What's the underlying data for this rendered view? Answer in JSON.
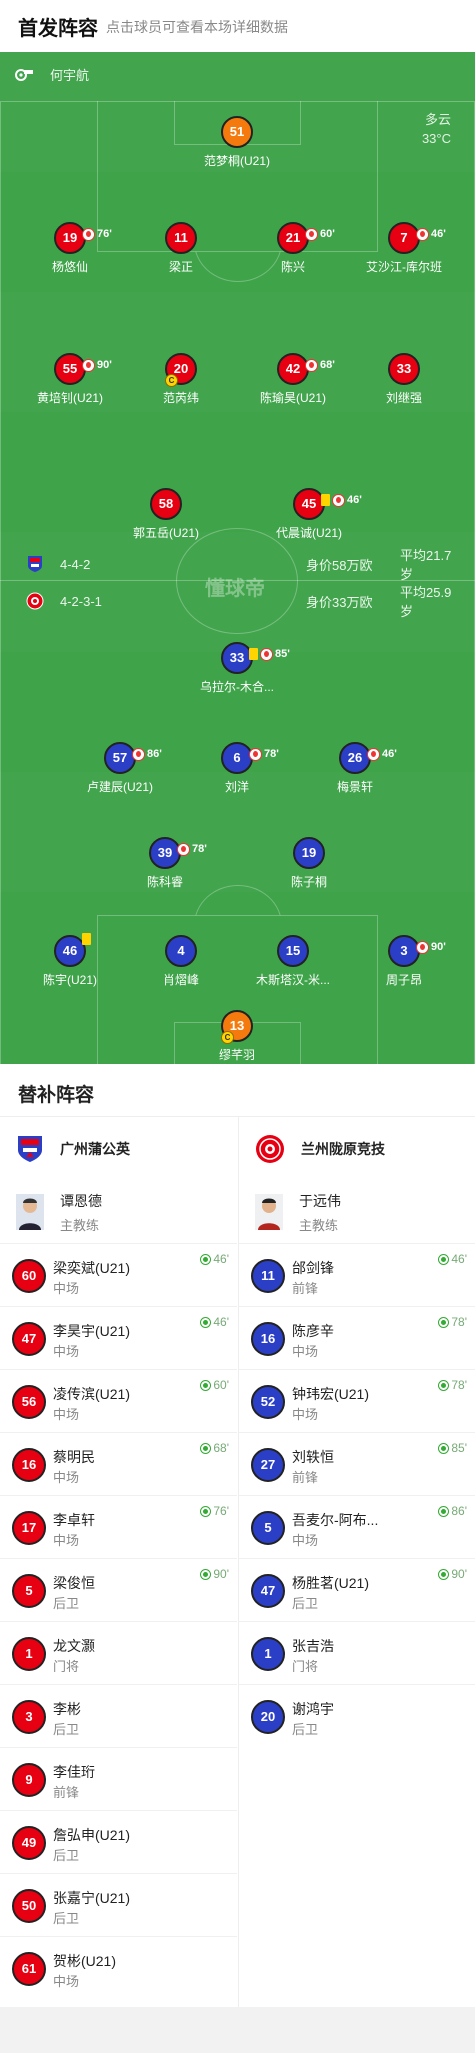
{
  "header": {
    "title": "首发阵容",
    "subtitle": "点击球员可查看本场详细数据"
  },
  "pitch": {
    "referee": "何宇航",
    "weather": "多云",
    "temperature": "33°C",
    "watermark": "懂球帝"
  },
  "home_formation": {
    "formation": "4-4-2",
    "value": "身价58万欧",
    "avg_age": "平均21.7岁"
  },
  "away_formation": {
    "formation": "4-2-3-1",
    "value": "身价33万欧",
    "avg_age": "平均25.9岁"
  },
  "home_players": [
    {
      "num": "51",
      "name": "范梦桐(U21)",
      "gk": true
    },
    {
      "num": "19",
      "name": "杨悠仙",
      "sub": "76'"
    },
    {
      "num": "11",
      "name": "梁正"
    },
    {
      "num": "21",
      "name": "陈兴",
      "sub": "60'"
    },
    {
      "num": "7",
      "name": "艾沙江-库尔班",
      "sub": "46'"
    },
    {
      "num": "55",
      "name": "黄培钊(U21)",
      "sub": "90'"
    },
    {
      "num": "20",
      "name": "范芮纬",
      "captain": true
    },
    {
      "num": "42",
      "name": "陈瑜昊(U21)",
      "sub": "68'"
    },
    {
      "num": "33",
      "name": "刘继强"
    },
    {
      "num": "58",
      "name": "郭五岳(U21)"
    },
    {
      "num": "45",
      "name": "代晨诚(U21)",
      "sub": "46'",
      "yellow": true
    }
  ],
  "away_players": [
    {
      "num": "33",
      "name": "乌拉尔-木合...",
      "sub": "85'",
      "yellow": true
    },
    {
      "num": "57",
      "name": "卢建辰(U21)",
      "sub": "86'"
    },
    {
      "num": "6",
      "name": "刘洋",
      "sub": "78'"
    },
    {
      "num": "26",
      "name": "梅景轩",
      "sub": "46'"
    },
    {
      "num": "39",
      "name": "陈科睿",
      "sub": "78'"
    },
    {
      "num": "19",
      "name": "陈子桐"
    },
    {
      "num": "46",
      "name": "陈宇(U21)",
      "yellow": true
    },
    {
      "num": "4",
      "name": "肖熠峰"
    },
    {
      "num": "15",
      "name": "木斯塔汉-米..."
    },
    {
      "num": "3",
      "name": "周子昂",
      "sub": "90'"
    },
    {
      "num": "13",
      "name": "缪芊羽",
      "gk": true,
      "captain": true
    }
  ],
  "captain_mark": "C",
  "substitutes": {
    "title": "替补阵容",
    "home": {
      "team": "广州蒲公英",
      "coach": {
        "name": "谭恩德",
        "role": "主教练"
      },
      "players": [
        {
          "num": "60",
          "name": "梁奕斌(U21)",
          "pos": "中场",
          "minute": "46'"
        },
        {
          "num": "47",
          "name": "李昊宇(U21)",
          "pos": "中场",
          "minute": "46'"
        },
        {
          "num": "56",
          "name": "凌传滨(U21)",
          "pos": "中场",
          "minute": "60'"
        },
        {
          "num": "16",
          "name": "蔡明民",
          "pos": "中场",
          "minute": "68'"
        },
        {
          "num": "17",
          "name": "李卓轩",
          "pos": "中场",
          "minute": "76'"
        },
        {
          "num": "5",
          "name": "梁俊恒",
          "pos": "后卫",
          "minute": "90'"
        },
        {
          "num": "1",
          "name": "龙文灏",
          "pos": "门将"
        },
        {
          "num": "3",
          "name": "李彬",
          "pos": "后卫"
        },
        {
          "num": "9",
          "name": "李佳珩",
          "pos": "前锋"
        },
        {
          "num": "49",
          "name": "詹弘申(U21)",
          "pos": "后卫"
        },
        {
          "num": "50",
          "name": "张嘉宁(U21)",
          "pos": "后卫"
        },
        {
          "num": "61",
          "name": "贺彬(U21)",
          "pos": "中场"
        }
      ]
    },
    "away": {
      "team": "兰州陇原竞技",
      "coach": {
        "name": "于远伟",
        "role": "主教练"
      },
      "players": [
        {
          "num": "11",
          "name": "邰剑锋",
          "pos": "前锋",
          "minute": "46'"
        },
        {
          "num": "16",
          "name": "陈彦辛",
          "pos": "中场",
          "minute": "78'"
        },
        {
          "num": "52",
          "name": "钟玮宏(U21)",
          "pos": "中场",
          "minute": "78'"
        },
        {
          "num": "27",
          "name": "刘轶恒",
          "pos": "前锋",
          "minute": "85'"
        },
        {
          "num": "5",
          "name": "吾麦尔-阿布...",
          "pos": "中场",
          "minute": "86'"
        },
        {
          "num": "47",
          "name": "杨胜茗(U21)",
          "pos": "后卫",
          "minute": "90'"
        },
        {
          "num": "1",
          "name": "张吉浩",
          "pos": "门将"
        },
        {
          "num": "20",
          "name": "谢鸿宇",
          "pos": "后卫"
        }
      ]
    }
  },
  "colors": {
    "pitch": "#3ea349",
    "home": "#e60012",
    "away": "#2b3fc6",
    "goalkeeper": "#f57a0e",
    "yellow_card": "#ffd400"
  }
}
